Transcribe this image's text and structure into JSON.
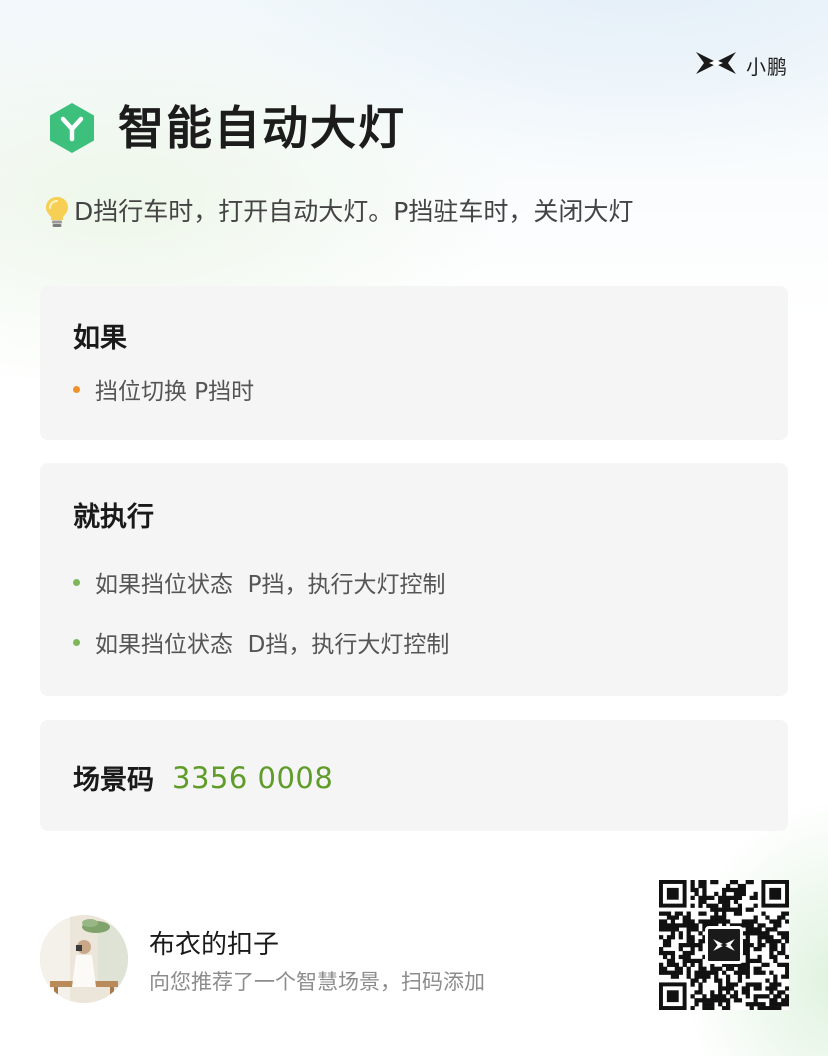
{
  "brand": {
    "name": "小鹏",
    "logo_icon": "xpeng-x-logo-icon"
  },
  "header": {
    "icon": "scene-y-hexagon-icon",
    "icon_color": "#3ec07d",
    "title": "智能自动大灯",
    "description_icon": "lightbulb-icon",
    "description": "D挡行车时，打开自动大灯。P挡驻车时，关闭大灯"
  },
  "condition_card": {
    "title": "如果",
    "bullet_color": "#f0922b",
    "items": [
      {
        "text": "挡位切换 P挡时"
      }
    ]
  },
  "action_card": {
    "title": "就执行",
    "bullet_color": "#7cb85a",
    "items": [
      {
        "text": "如果挡位状态  P挡，执行大灯控制"
      },
      {
        "text": "如果挡位状态  D挡，执行大灯控制"
      }
    ]
  },
  "scene_code": {
    "label": "场景码",
    "value": "3356 0008",
    "value_color": "#5f9c2a"
  },
  "sharer": {
    "avatar_icon": "user-avatar-photo",
    "name": "布衣的扣子",
    "message": "向您推荐了一个智慧场景，扫码添加"
  },
  "qr_code": {
    "icon": "qr-code-icon",
    "center_logo_icon": "xpeng-x-logo-icon"
  }
}
